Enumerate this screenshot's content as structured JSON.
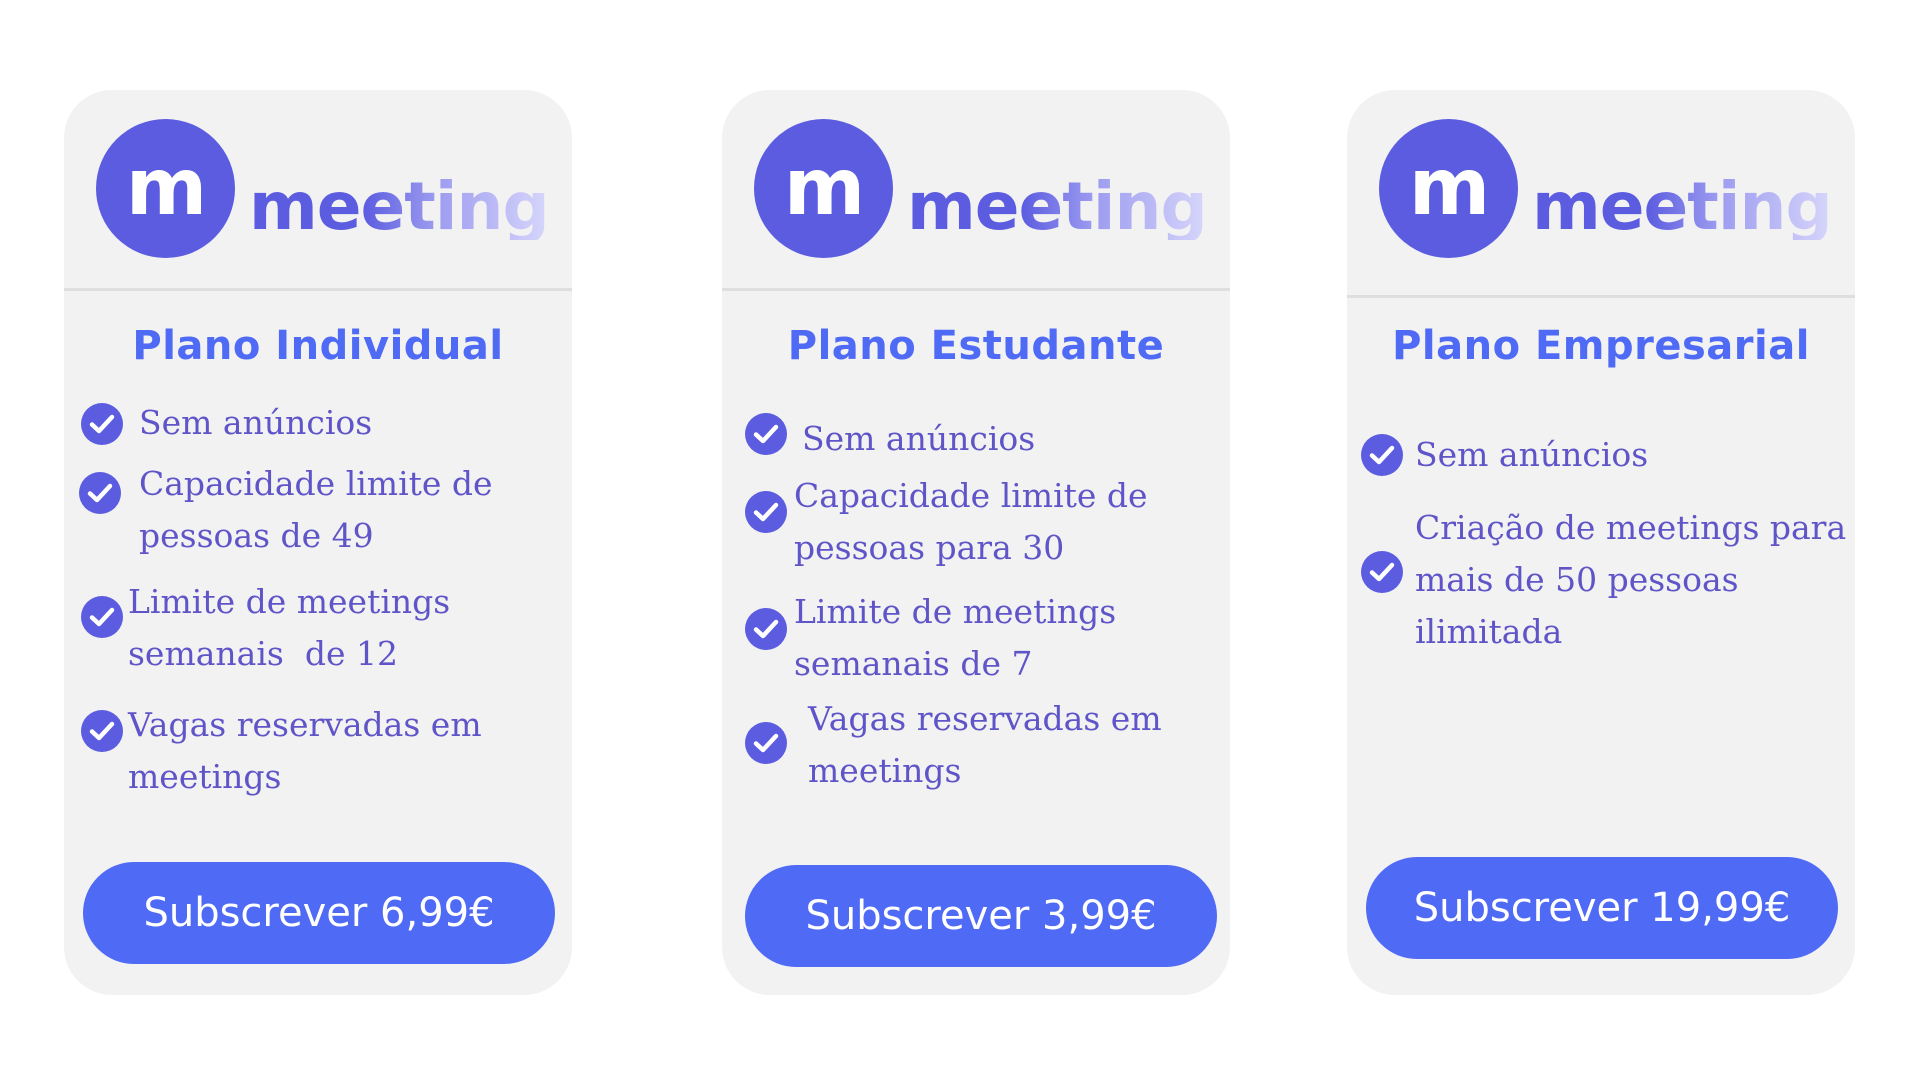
{
  "logo": {
    "badge_letter": "m",
    "wordmark": "meeting",
    "brand_color": "#5b5ce0",
    "wordmark_fade_color": "#d7d6fb"
  },
  "accent_color": "#4f6af5",
  "feature_text_color": "#5f55c8",
  "check_icon": "check-circle-icon",
  "plans": [
    {
      "title": "Plano Individual",
      "features": [
        "Sem anúncios",
        "Capacidade limite de\npessoas de 49",
        "Limite de meetings\nsemanais  de 12",
        "Vagas reservadas em\nmeetings"
      ],
      "button_label": "Subscrever 6,99€"
    },
    {
      "title": "Plano Estudante",
      "features": [
        "Sem anúncios",
        "Capacidade limite de\npessoas para 30",
        "Limite de meetings\nsemanais de 7",
        "Vagas reservadas em\nmeetings"
      ],
      "button_label": "Subscrever 3,99€"
    },
    {
      "title": "Plano Empresarial",
      "features": [
        "Sem anúncios",
        "Criação de meetings para\nmais de 50 pessoas\nilimitada"
      ],
      "button_label": "Subscrever 19,99€"
    }
  ]
}
